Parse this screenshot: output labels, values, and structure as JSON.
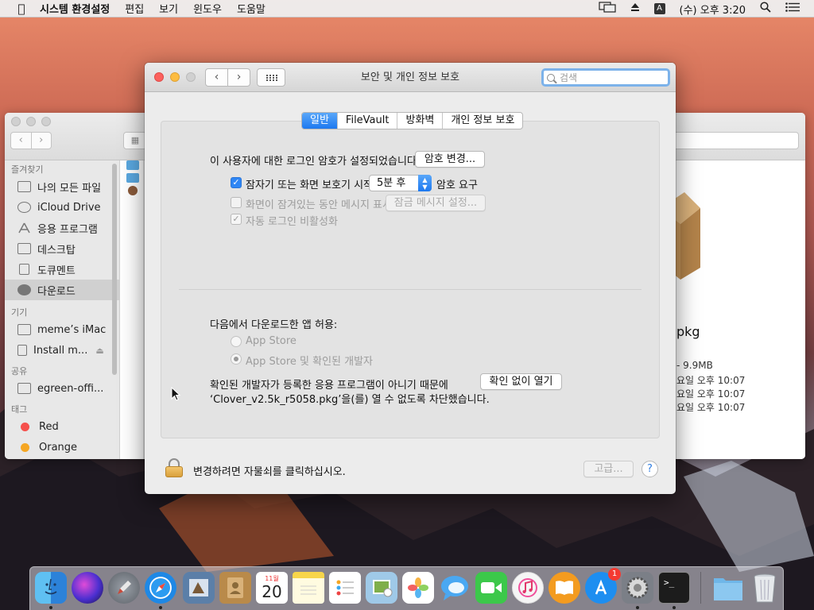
{
  "menubar": {
    "app_name": "시스템 환경설정",
    "menus": [
      "편집",
      "보기",
      "윈도우",
      "도움말"
    ],
    "ime_label": "A",
    "clock": "(수) 오후 3:20",
    "icons": [
      "apple-icon",
      "display-mirroring-icon",
      "eject-icon",
      "input-source-icon",
      "spotlight-icon",
      "notification-center-icon"
    ]
  },
  "finder": {
    "sections": {
      "favorites": "즐겨찾기",
      "devices": "기기",
      "shared": "공유",
      "tags": "태그"
    },
    "favorites": [
      "나의 모든 파일",
      "iCloud Drive",
      "응용 프로그램",
      "데스크탑",
      "도큐멘트",
      "다운로드"
    ],
    "devices": [
      "meme’s iMac",
      "Install m..."
    ],
    "shared": [
      "egreen-offi..."
    ],
    "tags": [
      {
        "label": "Red",
        "color": "#f5504c"
      },
      {
        "label": "Orange",
        "color": "#f5a623"
      }
    ],
    "preview": {
      "name": "pkg",
      "size": "- 9.9MB",
      "dates": [
        "요일 오후 10:07",
        "요일 오후 10:07",
        "요일 오후 10:07"
      ]
    }
  },
  "prefs": {
    "window_title": "보안 및 개인 정보 보호",
    "search_placeholder": "검색",
    "tabs": [
      {
        "label": "일반",
        "active": true
      },
      {
        "label": "FileVault",
        "active": false
      },
      {
        "label": "방화벽",
        "active": false
      },
      {
        "label": "개인 정보 보호",
        "active": false
      }
    ],
    "password_text": "이 사용자에 대한 로그인 암호가 설정되었습니다.",
    "change_password_button": "암호 변경...",
    "require_password": {
      "label_before": "잠자기 또는 화면 보호기 시작",
      "delay_value": "5분 후",
      "label_after": "암호 요구",
      "checked": true
    },
    "show_message": {
      "label": "화면이 잠겨있는 동안 메시지 표시",
      "checked": false,
      "button": "잠금 메시지 설정..."
    },
    "disable_auto_login": {
      "label": "자동 로그인 비활성화",
      "checked": true
    },
    "allow_apps_label": "다음에서 다운로드한 앱 허용:",
    "radio_options": [
      {
        "label": "App Store",
        "selected": false
      },
      {
        "label": "App Store 및 확인된 개발자",
        "selected": true
      }
    ],
    "blocked_message_line1": "확인된 개발자가 등록한 응용 프로그램이 아니기 때문에",
    "blocked_message_line2": "‘Clover_v2.5k_r5058.pkg’을(를) 열 수 없도록 차단했습니다.",
    "open_anyway_button": "확인 없이 열기",
    "lock_text": "변경하려면 자물쇠를 클릭하십시오.",
    "advanced_button": "고급...",
    "help_button": "?"
  },
  "dock": {
    "calendar_month": "11월",
    "calendar_day": "20",
    "app_store_badge": "1",
    "terminal_prompt": ">_",
    "items": [
      {
        "name": "finder-icon",
        "color": "#3a8ee6",
        "running": true
      },
      {
        "name": "siri-icon",
        "color": "#5b3fd1",
        "running": false
      },
      {
        "name": "launchpad-icon",
        "color": "#8a8f98",
        "running": false
      },
      {
        "name": "safari-icon",
        "color": "#1e88e5",
        "running": true
      },
      {
        "name": "preview-icon",
        "color": "#4f78b0",
        "running": false
      },
      {
        "name": "contacts-icon",
        "color": "#b98a4a",
        "running": false
      },
      {
        "name": "calendar-icon",
        "color": "#ffffff",
        "running": false
      },
      {
        "name": "notes-icon",
        "color": "#f7d54a",
        "running": false
      },
      {
        "name": "reminders-icon",
        "color": "#ffffff",
        "running": false
      },
      {
        "name": "photo-booth-icon",
        "color": "#7fae4a",
        "running": false
      },
      {
        "name": "photos-icon",
        "color": "#ffffff",
        "running": false
      },
      {
        "name": "messages-icon",
        "color": "#4aa8f2",
        "running": false
      },
      {
        "name": "facetime-icon",
        "color": "#3cc84a",
        "running": false
      },
      {
        "name": "itunes-icon",
        "color": "#f0f0f0",
        "running": false
      },
      {
        "name": "ibooks-icon",
        "color": "#f39b1f",
        "running": false
      },
      {
        "name": "app-store-icon",
        "color": "#1d8ef0",
        "running": false
      },
      {
        "name": "system-preferences-icon",
        "color": "#7b7f87",
        "running": true
      },
      {
        "name": "terminal-icon",
        "color": "#1c1c1c",
        "running": true
      },
      {
        "name": "downloads-stack-icon",
        "color": "#6fb6e8",
        "running": false
      },
      {
        "name": "trash-icon",
        "color": "#dfe3e8",
        "running": false
      }
    ]
  }
}
